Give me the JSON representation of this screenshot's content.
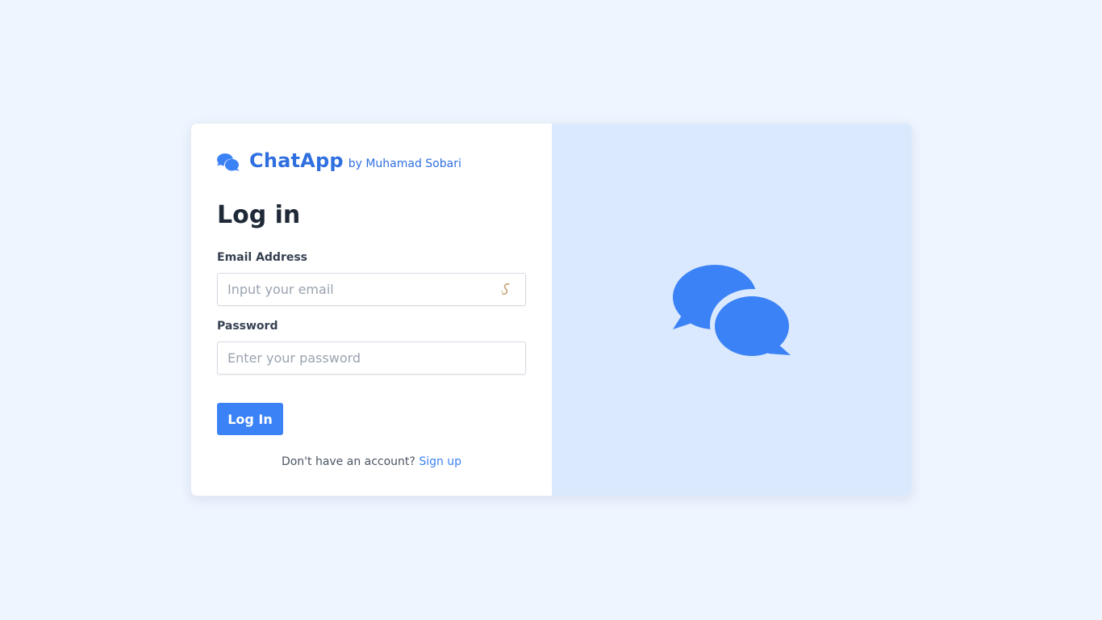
{
  "brand": {
    "name": "ChatApp",
    "byline": "by Muhamad Sobari",
    "icon": "comments-icon"
  },
  "form": {
    "title": "Log in",
    "email": {
      "label": "Email Address",
      "placeholder": "Input your email",
      "value": "",
      "icon": "password-manager-icon"
    },
    "password": {
      "label": "Password",
      "placeholder": "Enter your password",
      "value": ""
    },
    "submit_label": "Log In"
  },
  "signup": {
    "prompt": "Don't have an account?",
    "link_label": "Sign up"
  },
  "hero": {
    "icon": "comments-icon"
  },
  "colors": {
    "background": "#eef5ff",
    "accent": "#3b82f6",
    "brand": "#2f6fe0",
    "hero_panel": "#dbe9fe"
  }
}
